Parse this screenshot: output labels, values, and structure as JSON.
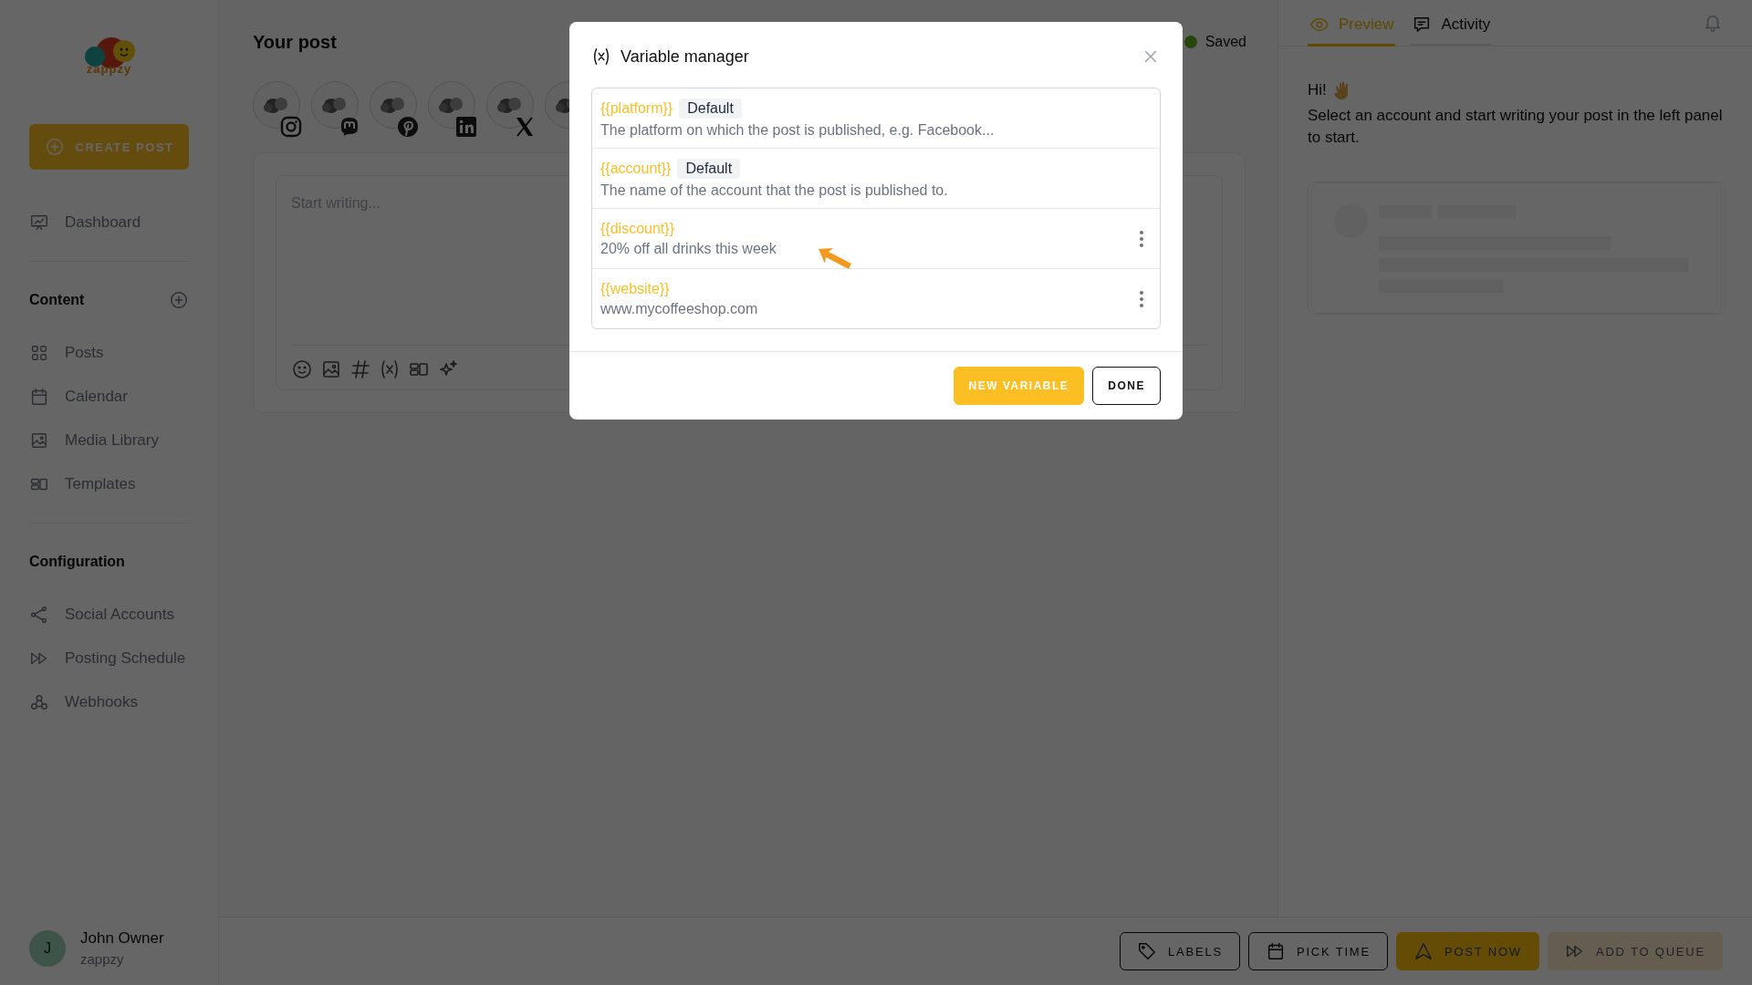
{
  "sidebar": {
    "logo_text": "zappzy",
    "create_button": "CREATE POST",
    "top_items": [
      {
        "label": "Dashboard"
      }
    ],
    "sections": [
      {
        "title": "Content",
        "add_button": true,
        "items": [
          {
            "label": "Posts"
          },
          {
            "label": "Calendar"
          },
          {
            "label": "Media Library"
          },
          {
            "label": "Templates"
          }
        ]
      },
      {
        "title": "Configuration",
        "add_button": false,
        "items": [
          {
            "label": "Social Accounts"
          },
          {
            "label": "Posting Schedule"
          },
          {
            "label": "Webhooks"
          }
        ]
      }
    ],
    "user": {
      "initial": "J",
      "name": "John Owner",
      "workspace": "zappzy"
    }
  },
  "editor": {
    "title": "Your post",
    "status": "Saved",
    "accounts": [
      {
        "kind": "instagram"
      },
      {
        "kind": "mastodon"
      },
      {
        "kind": "pinterest"
      },
      {
        "kind": "linkedin"
      },
      {
        "kind": "x"
      },
      {
        "kind": "other"
      }
    ],
    "placeholder": "Start writing..."
  },
  "preview": {
    "tabs": [
      {
        "label": "Preview",
        "selected": true
      },
      {
        "label": "Activity",
        "selected": false
      }
    ],
    "greeting": "Hi!",
    "message": "Select an account and start writing your post in the left panel to start."
  },
  "actions": [
    {
      "label": "LABELS",
      "kind": "outline"
    },
    {
      "label": "PICK TIME",
      "kind": "outline"
    },
    {
      "label": "POST NOW",
      "kind": "primary"
    },
    {
      "label": "ADD TO QUEUE",
      "kind": "soft"
    }
  ],
  "modal": {
    "title": "Variable manager",
    "variables": [
      {
        "name": "{{platform}}",
        "badge": "Default",
        "value": "The platform on which the post is published, e.g. Facebook...",
        "menu": false
      },
      {
        "name": "{{account}}",
        "badge": "Default",
        "value": "The name of the account that the post is published to.",
        "menu": false
      },
      {
        "name": "{{discount}}",
        "value": "20% off all drinks this week",
        "menu": true
      },
      {
        "name": "{{website}}",
        "value": "www.mycoffeeshop.com",
        "menu": true
      }
    ],
    "buttons": [
      {
        "label": "NEW VARIABLE",
        "kind": "primary"
      },
      {
        "label": "DONE",
        "kind": "outline"
      }
    ]
  }
}
